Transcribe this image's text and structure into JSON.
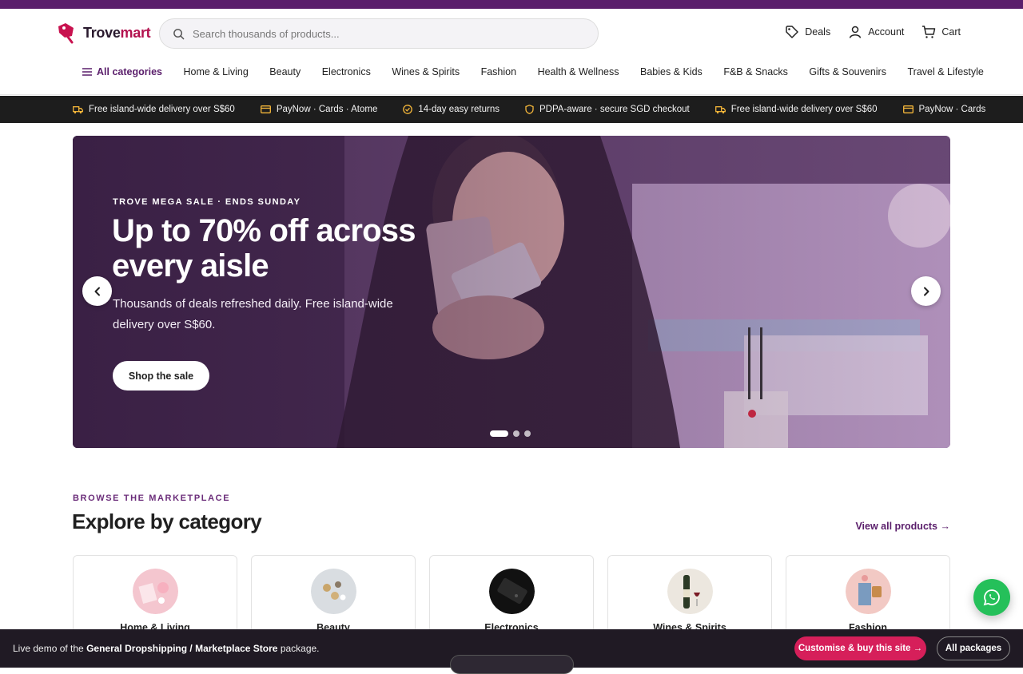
{
  "brand": {
    "name_main": "Trove",
    "name_accent": "mart"
  },
  "search": {
    "placeholder": "Search thousands of products..."
  },
  "header_actions": {
    "deals": "Deals",
    "account": "Account",
    "cart": "Cart"
  },
  "nav": {
    "all_categories": "All categories",
    "items": [
      "Home & Living",
      "Beauty",
      "Electronics",
      "Wines & Spirits",
      "Fashion",
      "Health & Wellness",
      "Babies & Kids",
      "F&B & Snacks",
      "Gifts & Souvenirs",
      "Travel & Lifestyle"
    ]
  },
  "trustbar": {
    "items": [
      {
        "icon": "truck-icon",
        "text": "Free island-wide delivery over S$60"
      },
      {
        "icon": "card-icon",
        "text": "PayNow · Cards · Atome"
      },
      {
        "icon": "check-circle-icon",
        "text": "14-day easy returns"
      },
      {
        "icon": "shield-icon",
        "text": "PDPA-aware · secure SGD checkout"
      },
      {
        "icon": "truck-icon",
        "text": "Free island-wide delivery over S$60"
      },
      {
        "icon": "card-icon",
        "text": "PayNow · Cards"
      }
    ],
    "icon_color": "#f5b73a"
  },
  "hero": {
    "eyebrow": "TROVE MEGA SALE · ENDS SUNDAY",
    "title": "Up to 70% off across every aisle",
    "subtitle": "Thousands of deals refreshed daily. Free island-wide delivery over S$60.",
    "cta": "Shop the sale",
    "slides": 3,
    "active_slide": 1
  },
  "browse": {
    "eyebrow": "BROWSE THE MARKETPLACE",
    "title": "Explore by category",
    "view_all": "View all products →",
    "categories": [
      "Home & Living",
      "Beauty",
      "Electronics",
      "Wines & Spirits",
      "Fashion"
    ]
  },
  "demo_bar": {
    "prefix": "Live demo of the",
    "package": "General Dropshipping / Marketplace Store",
    "suffix": "package.",
    "cta": "Customise & buy this site →",
    "all_packages": "All packages"
  },
  "colors": {
    "brand_purple": "#5a1e6b",
    "accent_pink": "#d61f5a",
    "whatsapp_green": "#25c05a"
  }
}
